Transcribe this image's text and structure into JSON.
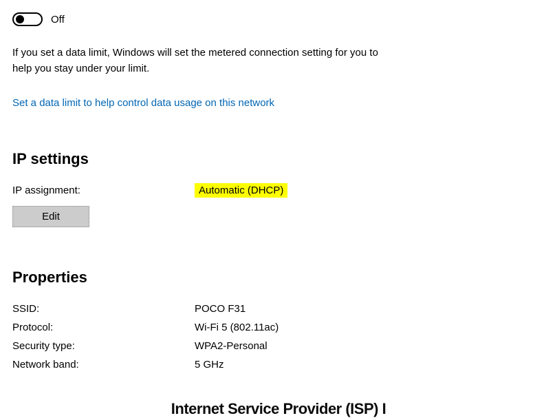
{
  "metered": {
    "toggle_state": "Off",
    "description": "If you set a data limit, Windows will set the metered connection setting for you to help you stay under your limit.",
    "link_text": "Set a data limit to help control data usage on this network"
  },
  "ip_settings": {
    "heading": "IP settings",
    "assignment_label": "IP assignment:",
    "assignment_value": "Automatic (DHCP)",
    "edit_label": "Edit"
  },
  "properties": {
    "heading": "Properties",
    "rows": [
      {
        "label": "SSID:",
        "value": "POCO F31"
      },
      {
        "label": "Protocol:",
        "value": "Wi-Fi 5 (802.11ac)"
      },
      {
        "label": "Security type:",
        "value": "WPA2-Personal"
      },
      {
        "label": "Network band:",
        "value": "5 GHz"
      }
    ]
  },
  "cutoff_text": "Internet Service Provider (ISP) I"
}
